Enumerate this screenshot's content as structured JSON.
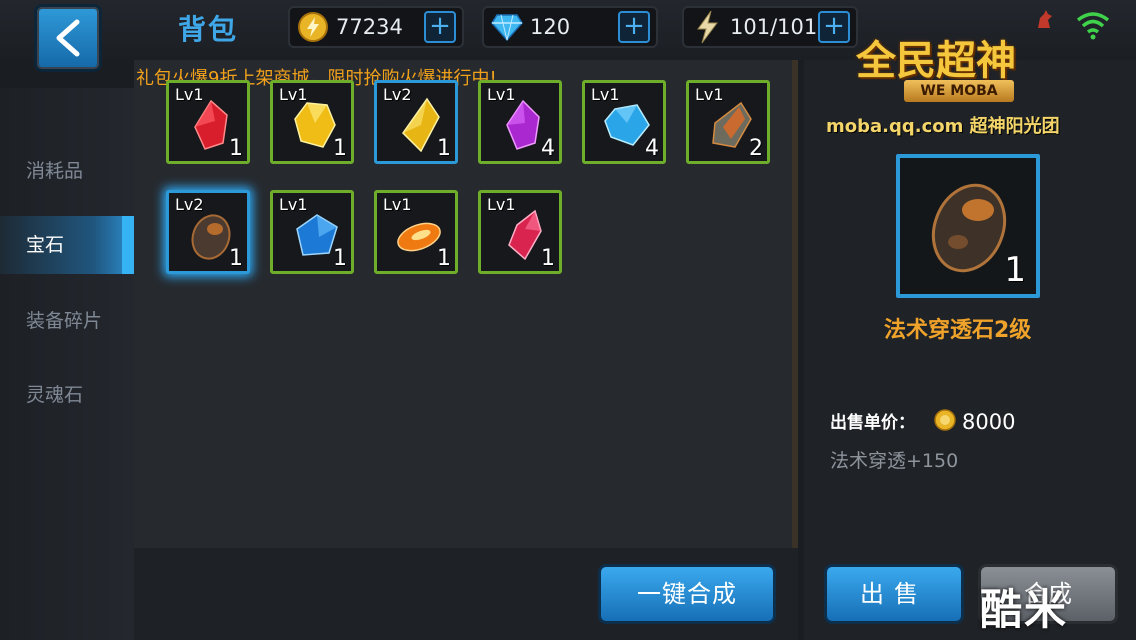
{
  "header": {
    "title": "背包",
    "gold": "77234",
    "diamonds": "120",
    "energy": "101/101",
    "plus": "+"
  },
  "promo": "礼包火爆9折上架商城，限时抢购火爆进行中!",
  "sidebar": {
    "items": [
      {
        "label": "消耗品",
        "active": false
      },
      {
        "label": "宝石",
        "active": true
      },
      {
        "label": "装备碎片",
        "active": false
      },
      {
        "label": "灵魂石",
        "active": false
      }
    ]
  },
  "grid": {
    "items": [
      {
        "level": "Lv1",
        "count": "1",
        "gem": "red",
        "color": "#e0202e"
      },
      {
        "level": "Lv1",
        "count": "1",
        "gem": "yellow",
        "color": "#f2c21a"
      },
      {
        "level": "Lv2",
        "count": "1",
        "gem": "yellow",
        "color": "#f2c21a"
      },
      {
        "level": "Lv1",
        "count": "4",
        "gem": "purple",
        "color": "#b430d6"
      },
      {
        "level": "Lv1",
        "count": "4",
        "gem": "cyan",
        "color": "#3ab6ee"
      },
      {
        "level": "Lv1",
        "count": "2",
        "gem": "fire-stone",
        "color": "#c4622a"
      },
      {
        "level": "Lv2",
        "count": "1",
        "gem": "dark-stone",
        "color": "#7a4a2a"
      },
      {
        "level": "Lv1",
        "count": "1",
        "gem": "blue",
        "color": "#1e7ed8"
      },
      {
        "level": "Lv1",
        "count": "1",
        "gem": "orange",
        "color": "#f38b1a"
      },
      {
        "level": "Lv1",
        "count": "1",
        "gem": "pink",
        "color": "#e0305e"
      }
    ]
  },
  "actions": {
    "merge_all": "一键合成",
    "sell": "出售",
    "merge": "合成"
  },
  "detail": {
    "count": "1",
    "name": "法术穿透石2级",
    "price_label": "出售单价：",
    "price": "8000",
    "effect": "法术穿透+150"
  },
  "logo": {
    "title": "全民超神",
    "subtitle": "WE MOBA",
    "url": "moba.qq.com 超神阳光团"
  },
  "watermark": "酷米"
}
